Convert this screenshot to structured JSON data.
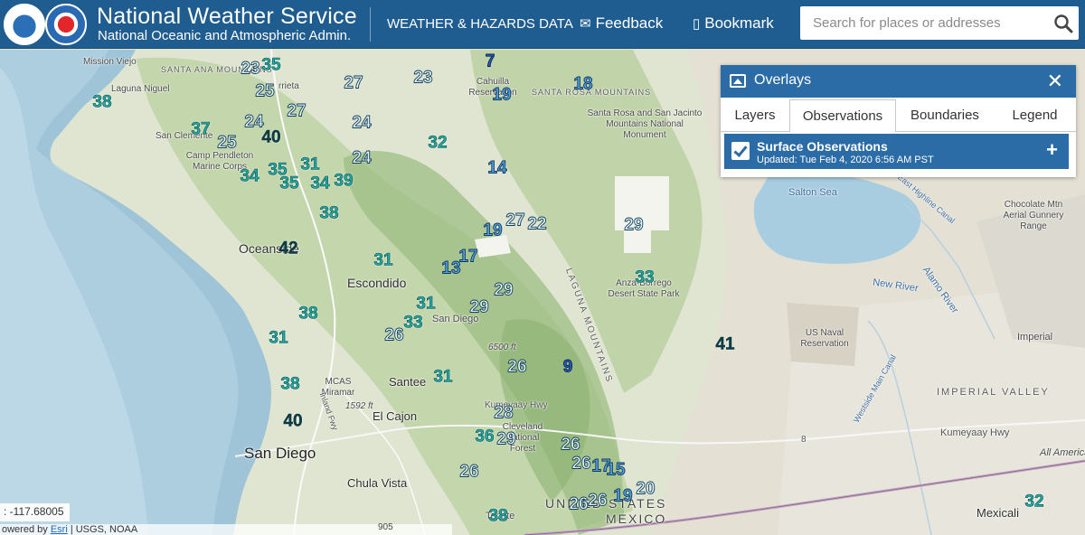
{
  "header": {
    "title": "National Weather Service",
    "subtitle": "National Oceanic and Atmospheric Admin.",
    "nav": {
      "weather_hazards": "WEATHER & HAZARDS DATA",
      "feedback": "Feedback",
      "bookmark": "Bookmark"
    },
    "search": {
      "placeholder": "Search for places or addresses",
      "value": ""
    }
  },
  "colors": {
    "header_bg": "#1f5c8f",
    "panel_bg": "#2b6ca6",
    "obs_teal": "#25a9a3",
    "obs_dark": "#0c3f46",
    "obs_light": "#e6f6fb",
    "obs_blue": "#4fa2e4",
    "obs_navy": "#2360c9"
  },
  "overlays_panel": {
    "title": "Overlays",
    "tabs": [
      {
        "label": "Layers",
        "active": false
      },
      {
        "label": "Observations",
        "active": true
      },
      {
        "label": "Boundaries",
        "active": false
      },
      {
        "label": "Legend",
        "active": false
      }
    ],
    "layer": {
      "name": "Surface Observations",
      "updated": "Updated: Tue Feb 4, 2020 6:56 AM PST",
      "checked": true
    }
  },
  "map_labels": {
    "mission_viejo": "Mission Viejo",
    "laguna_niguel": "Laguna Niguel",
    "santa_ana_mtns": "SANTA ANA MOUNTAINS",
    "murrieta": "rrieta",
    "cahuilla": "Cahuilla Reservation",
    "santa_rosa_mtns": "SANTA ROSA MOUNTAINS",
    "santa_rosa_monument": "Santa Rosa and San Jacinto Mountains National Monument",
    "san_clemente": "San Clemente",
    "camp_pendleton": "Camp Pendleton Marine Corps",
    "salton_sea": "Salton Sea",
    "chocolate_mtn": "Chocolate Mtn Aerial Gunnery Range",
    "east_highline": "East Highline Canal",
    "oceanside": "Oceanside",
    "escondido": "Escondido",
    "anza_borrego": "Anza-Borrego Desert State Park",
    "new_river": "New River",
    "alamo_river": "Alamo River",
    "us_naval": "US Naval Reservation",
    "imperial": "Imperial",
    "imperial_valley": "IMPERIAL VALLEY",
    "san_diego_river": "San Diego",
    "laguna_mtns": "LAGUNA MOUNTAINS",
    "elevation": "6500 ft",
    "mcas_miramar": "MCAS Miramar",
    "santee": "Santee",
    "westside_canal": "Westside Main Canal",
    "elevation2": "1592 ft",
    "inland_fwy": "Inland Fwy",
    "el_cajon": "El Cajon",
    "kumeyaay_hwy_west": "Kumeyaay Hwy",
    "cleveland_forest": "Cleveland National Forest",
    "kumeyaay_hwy_east": "Kumeyaay Hwy",
    "route_8": "8",
    "all_american": "All American",
    "san_diego": "San Diego",
    "chula_vista": "Chula Vista",
    "united_states": "UNITED STATES",
    "mexico": "MEXICO",
    "tecate": "Tecate",
    "mexicali": "Mexicali"
  },
  "observations": [
    {
      "value": "35",
      "style": "teal"
    },
    {
      "value": "23",
      "style": "light"
    },
    {
      "value": "7",
      "style": "navy"
    },
    {
      "value": "38",
      "style": "teal"
    },
    {
      "value": "25",
      "style": "light"
    },
    {
      "value": "27",
      "style": "light"
    },
    {
      "value": "23",
      "style": "light"
    },
    {
      "value": "19",
      "style": "blue"
    },
    {
      "value": "18",
      "style": "blue"
    },
    {
      "value": "27",
      "style": "light"
    },
    {
      "value": "24",
      "style": "light"
    },
    {
      "value": "24",
      "style": "light"
    },
    {
      "value": "37",
      "style": "teal"
    },
    {
      "value": "40",
      "style": "dark"
    },
    {
      "value": "25",
      "style": "light"
    },
    {
      "value": "32",
      "style": "teal"
    },
    {
      "value": "24",
      "style": "light"
    },
    {
      "value": "31",
      "style": "teal"
    },
    {
      "value": "14",
      "style": "blue"
    },
    {
      "value": "35",
      "style": "teal"
    },
    {
      "value": "34",
      "style": "teal"
    },
    {
      "value": "35",
      "style": "teal"
    },
    {
      "value": "34",
      "style": "teal"
    },
    {
      "value": "39",
      "style": "teal"
    },
    {
      "value": "38",
      "style": "teal"
    },
    {
      "value": "19",
      "style": "blue"
    },
    {
      "value": "27",
      "style": "light"
    },
    {
      "value": "22",
      "style": "light"
    },
    {
      "value": "29",
      "style": "light"
    },
    {
      "value": "42",
      "style": "dark"
    },
    {
      "value": "31",
      "style": "teal"
    },
    {
      "value": "17",
      "style": "blue"
    },
    {
      "value": "13",
      "style": "blue"
    },
    {
      "value": "33",
      "style": "teal"
    },
    {
      "value": "29",
      "style": "light"
    },
    {
      "value": "31",
      "style": "teal"
    },
    {
      "value": "29",
      "style": "light"
    },
    {
      "value": "38",
      "style": "teal"
    },
    {
      "value": "33",
      "style": "teal"
    },
    {
      "value": "26",
      "style": "light"
    },
    {
      "value": "31",
      "style": "teal"
    },
    {
      "value": "41",
      "style": "dark"
    },
    {
      "value": "26",
      "style": "light"
    },
    {
      "value": "9",
      "style": "navy"
    },
    {
      "value": "38",
      "style": "teal"
    },
    {
      "value": "31",
      "style": "teal"
    },
    {
      "value": "40",
      "style": "dark"
    },
    {
      "value": "28",
      "style": "light"
    },
    {
      "value": "36",
      "style": "teal"
    },
    {
      "value": "29",
      "style": "light"
    },
    {
      "value": "26",
      "style": "light"
    },
    {
      "value": "26",
      "style": "light"
    },
    {
      "value": "17",
      "style": "blue"
    },
    {
      "value": "15",
      "style": "blue"
    },
    {
      "value": "26",
      "style": "light"
    },
    {
      "value": "20",
      "style": "light"
    },
    {
      "value": "19",
      "style": "blue"
    },
    {
      "value": "26",
      "style": "light"
    },
    {
      "value": "26",
      "style": "light"
    },
    {
      "value": "38",
      "style": "teal"
    },
    {
      "value": "32",
      "style": "teal"
    }
  ],
  "coordinate_readout": ": -117.68005",
  "attribution": {
    "prefix": "owered by ",
    "esri": "Esri",
    "rest": " | USGS, NOAA"
  },
  "road_shield": "905"
}
